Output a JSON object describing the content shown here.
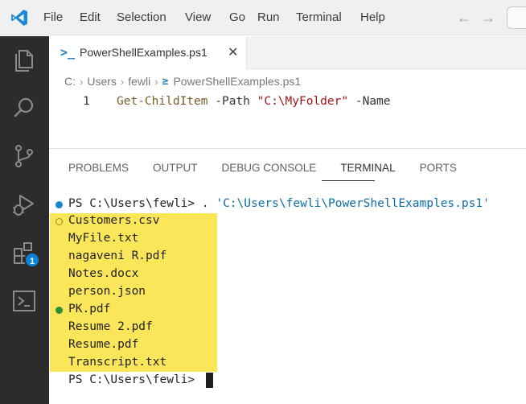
{
  "menu": [
    "File",
    "Edit",
    "Selection",
    "View",
    "Go",
    "Run",
    "Terminal",
    "Help"
  ],
  "nav": {
    "back": "←",
    "forward": "→"
  },
  "activity": {
    "extensions_badge": "1"
  },
  "tab": {
    "label": "PowerShellExamples.ps1",
    "icon": ">_",
    "close": "✕"
  },
  "breadcrumb": {
    "drive": "C:",
    "users": "Users",
    "user": "fewli",
    "file": "PowerShellExamples.ps1",
    "sep": "›",
    "file_icon": "≥"
  },
  "editor": {
    "line_number": "1",
    "cmdlet": "Get-ChildItem",
    "param1": " -Path ",
    "path_value": "\"C:\\MyFolder\"",
    "param2": " -Name"
  },
  "panel": {
    "tabs": [
      "PROBLEMS",
      "OUTPUT",
      "DEBUG CONSOLE",
      "TERMINAL",
      "PORTS"
    ],
    "active_tab": "TERMINAL"
  },
  "terminal": {
    "prompt": "PS C:\\Users\\fewli> ",
    "command_prefix": ". ",
    "command_path": "'C:\\Users\\fewli\\PowerShellExamples.ps1'",
    "output": [
      "Customers.csv",
      "MyFile.txt",
      "nagaveni R.pdf",
      "Notes.docx",
      "person.json",
      "PK.pdf",
      "Resume 2.pdf",
      "Resume.pdf",
      "Transcript.txt"
    ],
    "final_prompt": "PS C:\\Users\\fewli> "
  },
  "colors": {
    "activity_bar": "#2c2c2c",
    "highlight": "#fbe65a",
    "accent": "#0a84d6"
  }
}
